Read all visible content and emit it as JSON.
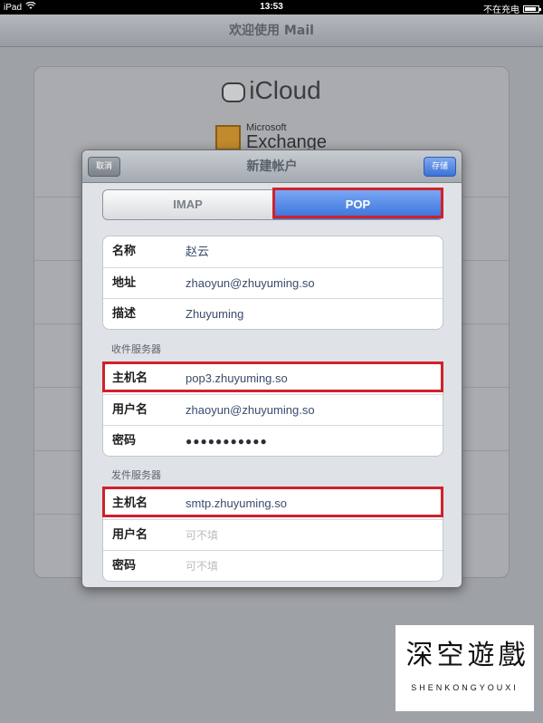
{
  "status_bar": {
    "device": "iPad",
    "time": "13:53",
    "charging": "不在充电",
    "battery_level": 0.85
  },
  "background": {
    "title": "欢迎使用 Mail",
    "providers": {
      "icloud": "iCloud",
      "exchange_line1": "Microsoft",
      "exchange_line2": "Exchange"
    }
  },
  "modal": {
    "title": "新建帐户",
    "cancel_label": "取消",
    "save_label": "存储",
    "segments": {
      "imap": "IMAP",
      "pop": "POP",
      "selected": "POP"
    },
    "account": {
      "name_label": "名称",
      "name_value": "赵云",
      "address_label": "地址",
      "address_value": "zhaoyun@zhuyuming.so",
      "description_label": "描述",
      "description_value": "Zhuyuming"
    },
    "incoming": {
      "header": "收件服务器",
      "host_label": "主机名",
      "host_value": "pop3.zhuyuming.so",
      "user_label": "用户名",
      "user_value": "zhaoyun@zhuyuming.so",
      "password_label": "密码",
      "password_value": "●●●●●●●●●●●"
    },
    "outgoing": {
      "header": "发件服务器",
      "host_label": "主机名",
      "host_value": "smtp.zhuyuming.so",
      "user_label": "用户名",
      "user_placeholder": "可不填",
      "password_label": "密码",
      "password_placeholder": "可不填"
    }
  },
  "watermark": {
    "chars": [
      "深",
      "空",
      "遊",
      "戲"
    ],
    "subtitle": "SHENKONGYOUXI"
  },
  "colors": {
    "highlight": "#d1212a",
    "accent": "#3770db"
  }
}
